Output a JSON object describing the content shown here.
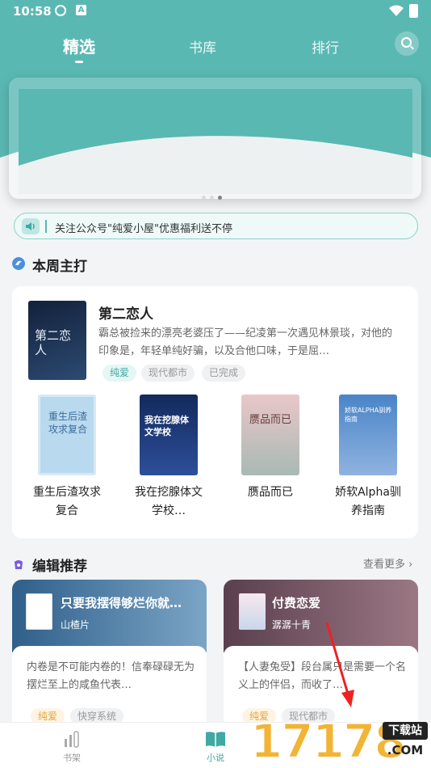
{
  "status_bar": {
    "time": "10:58",
    "icon_b": "A"
  },
  "top_tabs": [
    {
      "label": "精选",
      "active": true
    },
    {
      "label": "书库",
      "active": false
    },
    {
      "label": "排行",
      "active": false
    }
  ],
  "banner": {
    "dots": 3,
    "active_dot": 3
  },
  "notice": {
    "text": "关注公众号\"纯爱小屋\"优惠福利送不停"
  },
  "weekly": {
    "title": "本周主打",
    "featured": {
      "cover_text": "第二恋人",
      "title": "第二恋人",
      "description": "霸总被捡来的漂亮老婆压了——纪凌第一次遇见林景琰，对他的印象是，年轻单纯好骗，以及合他口味，于是屈…",
      "tags": [
        "纯爱",
        "现代都市",
        "已完成"
      ]
    },
    "books": [
      {
        "title": "重生后渣攻求复合",
        "cover_text": "重生后渣攻求复合"
      },
      {
        "title": "我在挖腺体文学校…",
        "cover_text": "我在挖腺体文学校"
      },
      {
        "title": "赝品而已",
        "cover_text": "赝品而已"
      },
      {
        "title": "娇软Alpha驯养指南",
        "cover_text": "娇软ALPHA驯养指南"
      }
    ]
  },
  "editor": {
    "title": "编辑推荐",
    "more": "查看更多",
    "cards": [
      {
        "title": "只要我摆得够烂你就…",
        "author": "山楂片",
        "description": "内卷是不可能内卷的！信奉碌碌无为摆烂至上的咸鱼代表…",
        "tags": [
          "纯爱",
          "快穿系统"
        ]
      },
      {
        "title": "付费恋爱",
        "author": "潺潺十青",
        "description": "【人妻兔受】段台属只是需要一个名义上的伴侣，而收了…",
        "tags": [
          "纯爱",
          "现代都市"
        ]
      }
    ]
  },
  "bottom_nav": [
    {
      "label": "书架",
      "active": false
    },
    {
      "label": "小说",
      "active": true
    }
  ],
  "watermark": {
    "number": "17178",
    "badge": "下载站",
    "domain": ".COM"
  }
}
